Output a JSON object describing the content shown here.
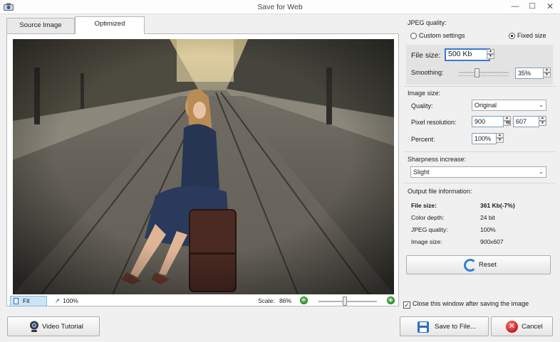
{
  "window": {
    "title": "Save for Web",
    "minimize_glyph": "—",
    "maximize_glyph": "☐",
    "close_glyph": "✕"
  },
  "tabs": [
    {
      "label": "Source Image",
      "selected": false
    },
    {
      "label": "Optimized",
      "selected": true
    }
  ],
  "preview": {
    "fit_label": "Fit",
    "actual_label": "100%",
    "scale_label": "Scale:",
    "scale_value": "86%",
    "zoom_level": 0.45,
    "zoom_minus_glyph": "−",
    "zoom_plus_glyph": "+"
  },
  "jpeg_quality": {
    "section_title": "JPEG quality:",
    "custom_label": "Custom settings",
    "fixed_label": "Fixed size",
    "selected_mode": "fixed",
    "file_size_label": "File size:",
    "file_size_value": "500 Kb",
    "smoothing_label": "Smoothing:",
    "smoothing_value": "35%",
    "smoothing_level": 0.35
  },
  "image_size": {
    "section_title": "Image size:",
    "quality_label": "Quality:",
    "quality_value": "Original",
    "resolution_label": "Pixel resolution:",
    "width": "900",
    "times": "x",
    "height": "607",
    "percent_label": "Percent:",
    "percent_value": "100%"
  },
  "sharpness": {
    "section_title": "Sharpness increase:",
    "value": "Slight"
  },
  "output_info": {
    "section_title": "Output file information:",
    "rows": [
      {
        "label": "File size:",
        "value": "361 Kb(-7%)"
      },
      {
        "label": "Color depth:",
        "value": "24 bit"
      },
      {
        "label": "JPEG quality:",
        "value": "100%"
      },
      {
        "label": "Image size:",
        "value": "900x607"
      }
    ]
  },
  "buttons": {
    "reset": "Reset",
    "video_tutorial": "Video Tutorial",
    "save_to_file": "Save to File...",
    "cancel": "Cancel"
  },
  "close_after_save": {
    "label": "Close this window after saving the image",
    "checked": true,
    "check_glyph": "✓"
  },
  "icons": {
    "app": "app-icon",
    "fit": "fit-icon",
    "actual_size": "actual-size-icon",
    "reset": "refresh-icon",
    "video": "webcam-icon",
    "save": "floppy-disk-icon",
    "cancel": "cancel-x-icon"
  },
  "colors": {
    "accent": "#2f7fd6",
    "zoom_green": "#2e9a2e",
    "cancel_red": "#c61a1a",
    "selection_blue": "#cce4f7"
  }
}
